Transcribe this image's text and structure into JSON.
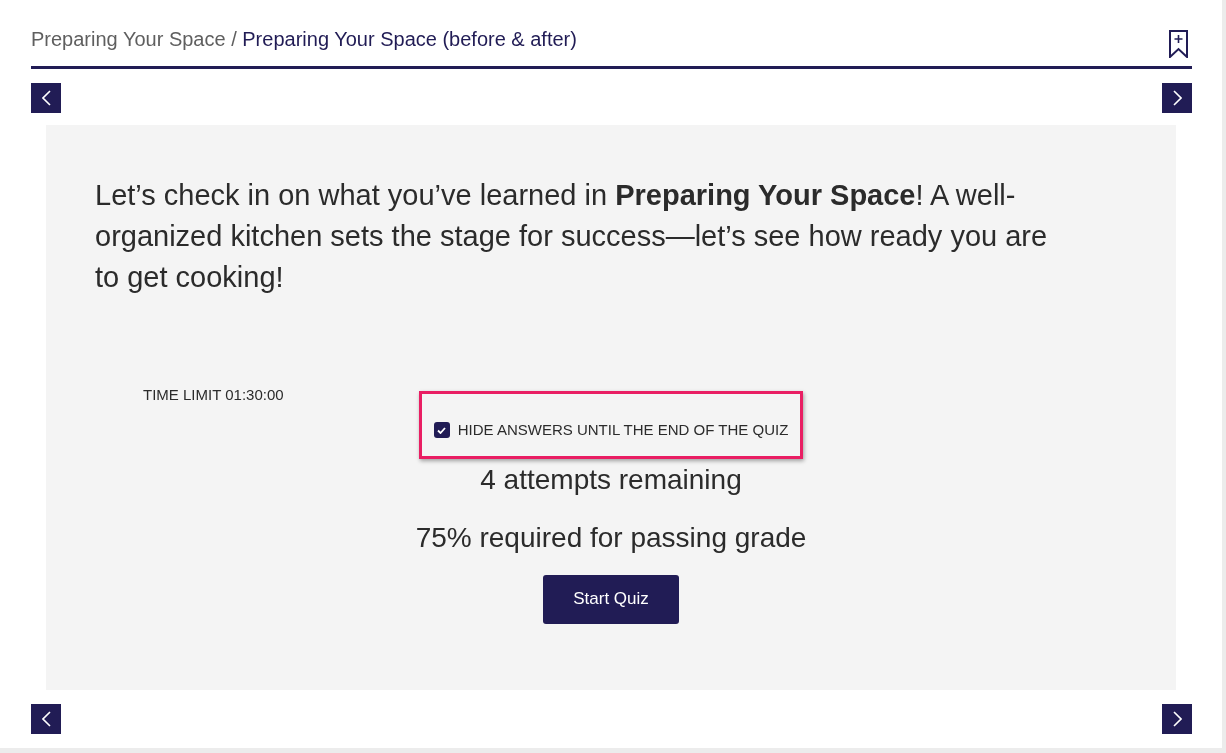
{
  "breadcrumb": {
    "parent": "Preparing Your Space",
    "separator": "/",
    "current": "Preparing Your Space (before & after)"
  },
  "intro": "Let’s check in on what you’ve learned in **Preparing Your Space**! A well-organized kitchen sets the stage for success—let’s see how ready you are to get cooking!",
  "quiz": {
    "time_limit": "TIME LIMIT 01:30:00",
    "hide_answers": {
      "label": "HIDE ANSWERS UNTIL THE END OF THE QUIZ",
      "checked": true,
      "highlighted": true
    },
    "attempts": "4 attempts remaining",
    "passing": "75% required for passing grade",
    "start_button": "Start Quiz"
  }
}
